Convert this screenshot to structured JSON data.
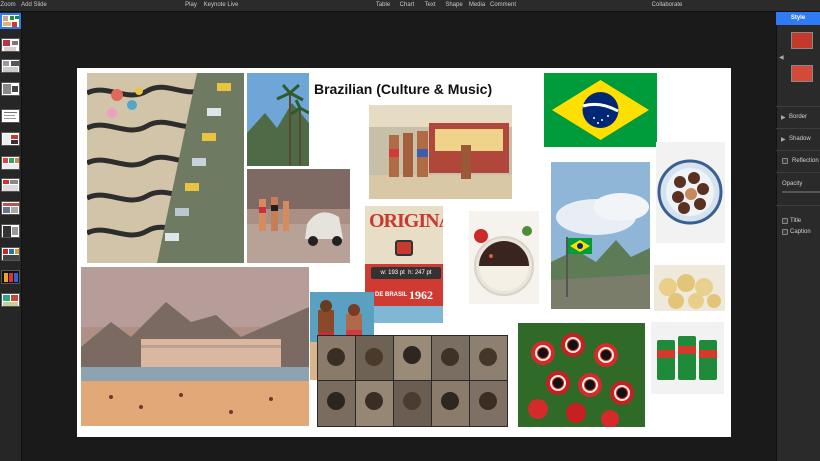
{
  "toolbar": {
    "zoom": "Zoom",
    "add_slide": "Add Slide",
    "play": "Play",
    "keynote_live": "Keynote Live",
    "table": "Table",
    "chart": "Chart",
    "text": "Text",
    "shape": "Shape",
    "media": "Media",
    "comment": "Comment",
    "collaborate": "Collaborate"
  },
  "slide": {
    "title": "Brazilian (Culture & Music)",
    "poster": {
      "headline": "ORIGINAL",
      "brand": "DE BRASIL",
      "year": "1962"
    },
    "size_tooltip": {
      "width": "w: 193 pt",
      "height": "h: 247 pt"
    }
  },
  "inspector": {
    "style_tab": "Style",
    "border": "Border",
    "shadow": "Shadow",
    "reflection": "Reflection",
    "opacity": "Opacity",
    "title": "Title",
    "caption": "Caption"
  },
  "colors": {
    "accent": "#2f7bf5",
    "brazil_green": "#009b3a",
    "brazil_yellow": "#fedf00",
    "brazil_blue": "#002776"
  }
}
